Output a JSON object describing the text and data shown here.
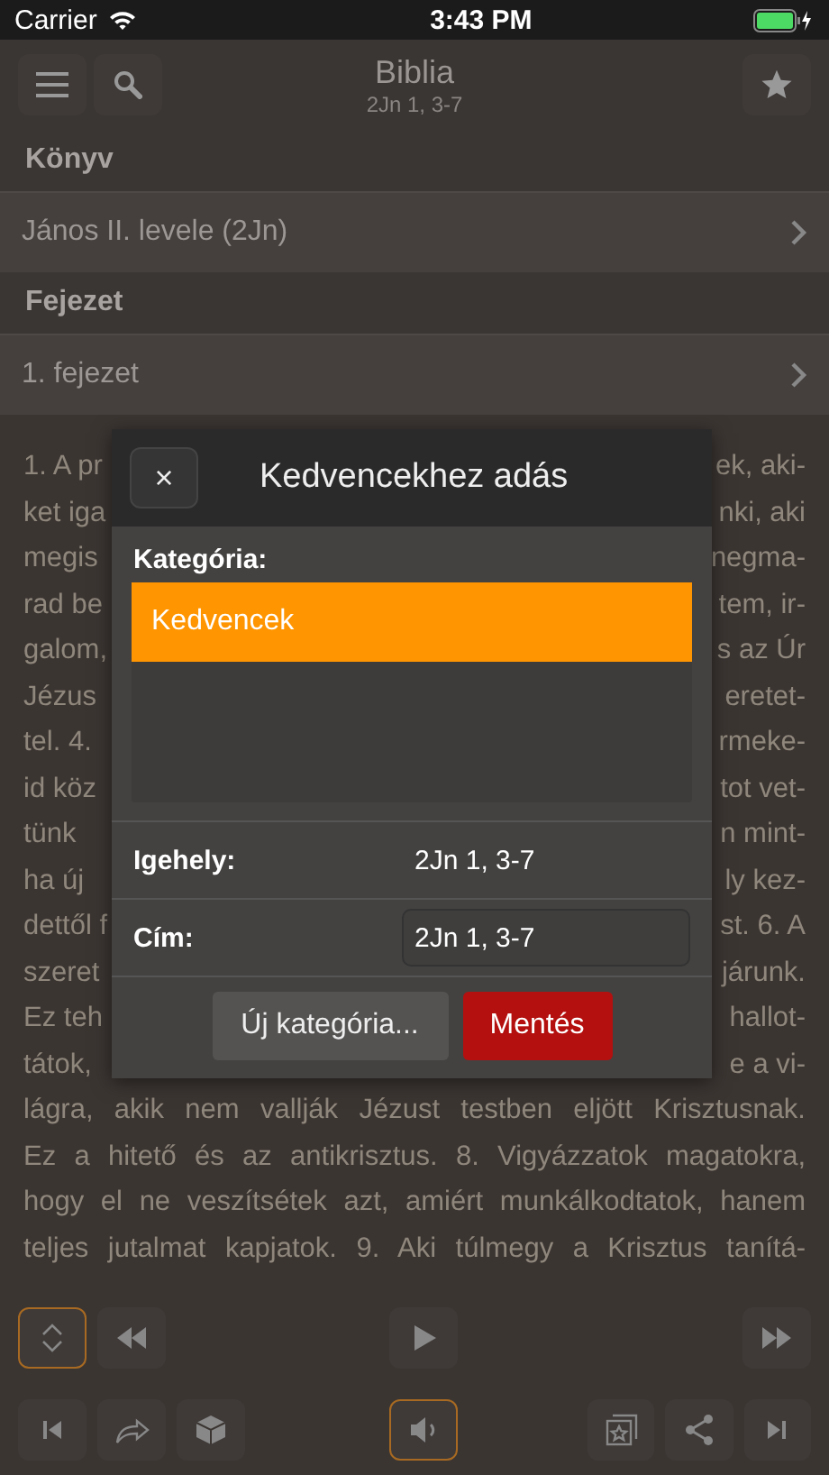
{
  "status_bar": {
    "carrier": "Carrier",
    "time": "3:43 PM"
  },
  "nav": {
    "title": "Biblia",
    "subtitle": "2Jn 1, 3-7"
  },
  "sections": [
    {
      "header": "Könyv",
      "value": "János II. levele (2Jn)"
    },
    {
      "header": "Fejezet",
      "value": "1. fejezet"
    }
  ],
  "passage": [
    {
      "left": "1. A pr",
      "right": "ek, aki-"
    },
    {
      "left": "ket iga",
      "right": "nki, aki"
    },
    {
      "left": "megis",
      "right": "negma-"
    },
    {
      "left": "rad be",
      "right": "tem, ir-"
    },
    {
      "left": "galom,",
      "right": "s az Úr"
    },
    {
      "left": "Jézus",
      "right": "eretet-"
    },
    {
      "left": "tel. 4.",
      "right": "rmeke-"
    },
    {
      "left": "id köz",
      "right": "tot vet-"
    },
    {
      "left": "tünk",
      "right": "n mint-"
    },
    {
      "left": "ha új",
      "right": "ly kez-"
    },
    {
      "left": "dettől f",
      "right": "st. 6. A"
    },
    {
      "left": "szeret",
      "right": "járunk."
    },
    {
      "left": "Ez teh",
      "right": "hallot-"
    },
    {
      "left": "tátok,",
      "right": "e a vi-"
    },
    {
      "left": "lágra, akik nem vallják Jézust testben eljött Krisztusnak."
    },
    {
      "left": "Ez a hitető és az antikrisztus. 8. Vigyázzatok magatokra,"
    },
    {
      "left": "hogy el ne veszítsétek azt, amiért munkálkodtatok, hanem"
    },
    {
      "left": "teljes jutalmat kapjatok. 9. Aki túlmegy a Krisztus tanítá-"
    }
  ],
  "dialog": {
    "close": "×",
    "title": "Kedvencekhez adás",
    "category_label": "Kategória:",
    "categories": [
      {
        "label": "Kedvencek",
        "selected": true
      }
    ],
    "fields": [
      {
        "kind": "text",
        "label": "Igehely:",
        "value": "2Jn 1, 3-7"
      },
      {
        "kind": "input",
        "label": "Cím:",
        "value": "2Jn 1, 3-7"
      }
    ],
    "buttons": [
      {
        "kind": "secondary",
        "label": "Új kategória..."
      },
      {
        "kind": "primary",
        "label": "Mentés"
      }
    ]
  },
  "toolbar_top": [
    {
      "kind": "updown",
      "selected": true
    },
    {
      "kind": "rewind",
      "selected": false
    },
    {
      "kind": "play",
      "selected": false
    },
    {
      "kind": "forward",
      "selected": false
    }
  ],
  "toolbar_bottom": [
    {
      "kind": "first",
      "selected": false
    },
    {
      "kind": "redo",
      "selected": false
    },
    {
      "kind": "dice",
      "selected": false
    },
    {
      "kind": "speaker",
      "selected": true
    },
    {
      "kind": "favorites",
      "selected": false
    },
    {
      "kind": "share",
      "selected": false
    },
    {
      "kind": "last",
      "selected": false
    }
  ]
}
